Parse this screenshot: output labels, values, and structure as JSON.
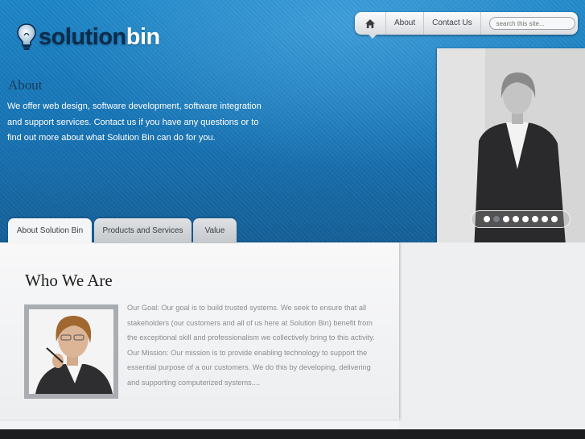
{
  "brand": {
    "name_part1": "solution",
    "name_part2": "bin"
  },
  "nav": {
    "home_icon": "home-icon",
    "items": [
      "About",
      "Contact Us"
    ],
    "search_placeholder": "search this site..."
  },
  "intro": {
    "title": "About",
    "body": "We offer web design, software development, software integration and support services. Contact us if you have any questions or to find out more about what Solution Bin can do for you."
  },
  "slider": {
    "dot_count": 8,
    "active_index": 1
  },
  "tabs": [
    {
      "label": "About Solution Bin",
      "active": true
    },
    {
      "label": "Products and Services",
      "active": false
    },
    {
      "label": "Value",
      "active": false
    }
  ],
  "content": {
    "title": "Who We Are",
    "body": "Our Goal: Our goal is to build trusted systems. We seek to ensure that all stakeholders (our customers and all of us here at Solution Bin) benefit from the exceptional skill and professionalism we collectively bring to this activity. Our Mission: Our mission is to provide enabling technology to support the essential purpose of a our customers. We do this by developing, delivering and supporting computerized systems...."
  },
  "colors": {
    "hero_blue": "#1773b4",
    "logo_dark": "#0c2c4c",
    "footer": "#1c1d1f"
  }
}
